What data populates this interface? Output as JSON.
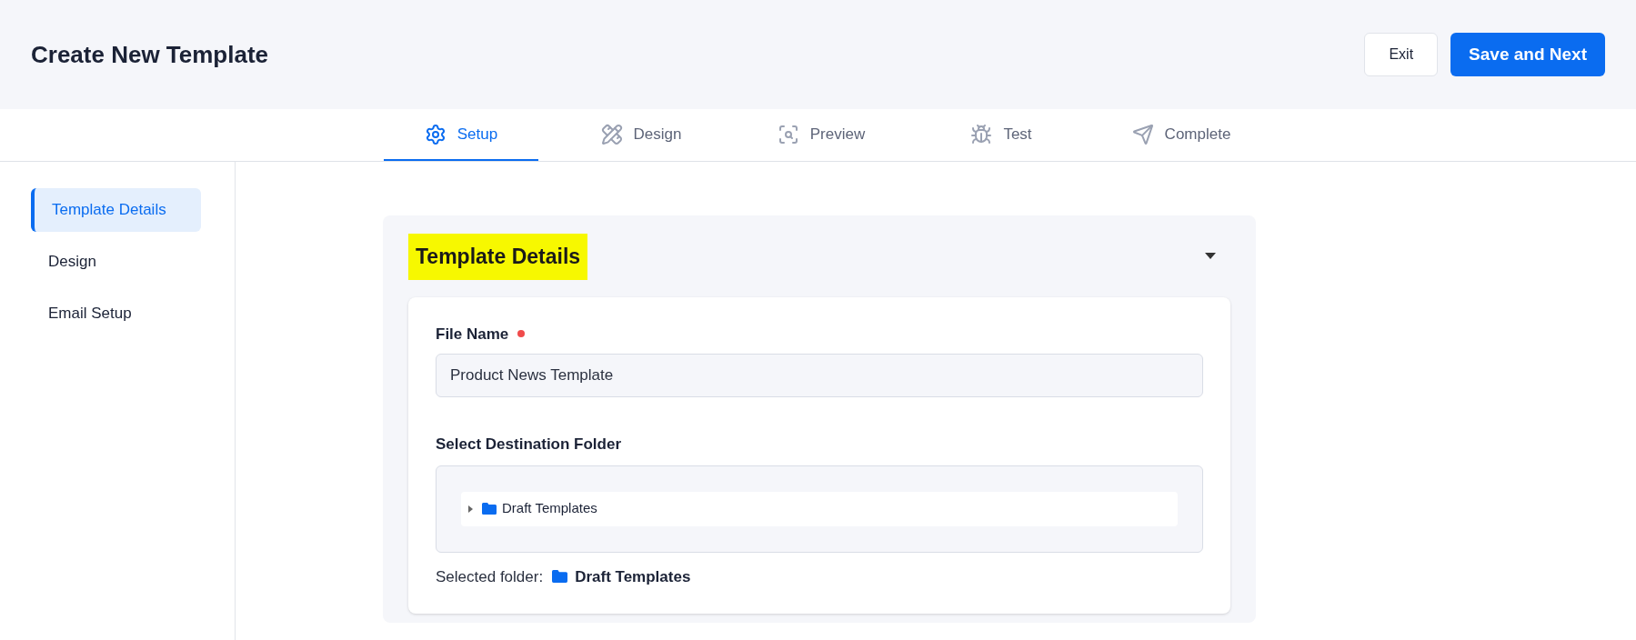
{
  "header": {
    "title": "Create New Template",
    "buttons": [
      {
        "label": "Exit",
        "kind": "secondary"
      },
      {
        "label": "Save and Next",
        "kind": "primary"
      }
    ]
  },
  "tabs": [
    {
      "label": "Setup",
      "kind": "setup",
      "selected": true
    },
    {
      "label": "Design",
      "kind": "design",
      "selected": false
    },
    {
      "label": "Preview",
      "kind": "preview",
      "selected": false
    },
    {
      "label": "Test",
      "kind": "test",
      "selected": false
    },
    {
      "label": "Complete",
      "kind": "complete",
      "selected": false
    }
  ],
  "sidebar": {
    "items": [
      {
        "label": "Template Details",
        "selected": true
      },
      {
        "label": "Design",
        "selected": false
      },
      {
        "label": "Email Setup",
        "selected": false
      }
    ]
  },
  "section": {
    "title": "Template Details",
    "expanded": true,
    "file_name": {
      "label": "File Name",
      "required": true,
      "value": "Product News Template"
    },
    "destination": {
      "label": "Select Destination Folder",
      "tree": [
        {
          "label": "Draft Templates",
          "expanded": false
        }
      ]
    },
    "selected_folder": {
      "label": "Selected folder:",
      "value": "Draft Templates"
    }
  }
}
